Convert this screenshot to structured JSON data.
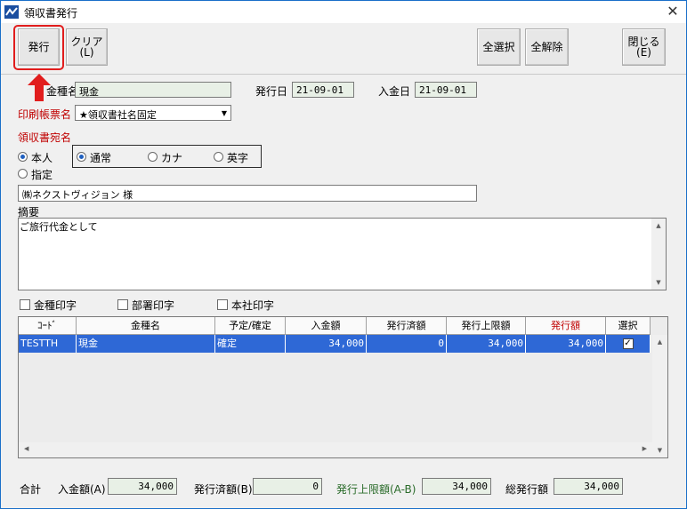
{
  "window": {
    "title": "領収書発行",
    "close_glyph": "✕"
  },
  "toolbar": {
    "issue_label": "発行",
    "clear_label": "クリア",
    "clear_key": "(L)",
    "select_all_label": "全選択",
    "deselect_all_label": "全解除",
    "close_label": "閉じる",
    "close_key": "(E)"
  },
  "form": {
    "kinsyu_label": "金種名",
    "kinsyu_value": "現金",
    "issue_date_label": "発行日",
    "issue_date_value": "21-09-01",
    "deposit_date_label": "入金日",
    "deposit_date_value": "21-09-01",
    "print_form_label": "印刷帳票名",
    "print_form_value": "★領収書社名固定",
    "receipt_addressee_label": "領収書宛名",
    "radio_person_label": "本人",
    "radio_specify_label": "指定",
    "mode_normal_label": "通常",
    "mode_kana_label": "カナ",
    "mode_english_label": "英字",
    "addressee_value": "㈱ネクストヴィジョン 様",
    "memo_label": "摘要",
    "memo_value": "ご旅行代金として"
  },
  "options": {
    "print_kinsyu_label": "金種印字",
    "print_dept_label": "部署印字",
    "print_hq_label": "本社印字"
  },
  "grid": {
    "headers": [
      "ｺｰﾄﾞ",
      "金種名",
      "予定/確定",
      "入金額",
      "発行済額",
      "発行上限額",
      "発行額",
      "選択"
    ],
    "rows": [
      {
        "code": "TESTTH",
        "kinsyu": "現金",
        "status": "確定",
        "deposit": "34,000",
        "issued": "0",
        "limit": "34,000",
        "amount": "34,000",
        "selected": "✓"
      }
    ]
  },
  "totals": {
    "label": "合計",
    "deposit_label": "入金額(A)",
    "deposit_value": "34,000",
    "issued_label": "発行済額(B)",
    "issued_value": "0",
    "limit_label": "発行上限額(A-B)",
    "limit_value": "34,000",
    "total_issue_label": "総発行額",
    "total_issue_value": "34,000"
  },
  "colors": {
    "accent_red": "#c00000",
    "row_selected": "#2e68d6",
    "annotation_red": "#e11d1d"
  }
}
